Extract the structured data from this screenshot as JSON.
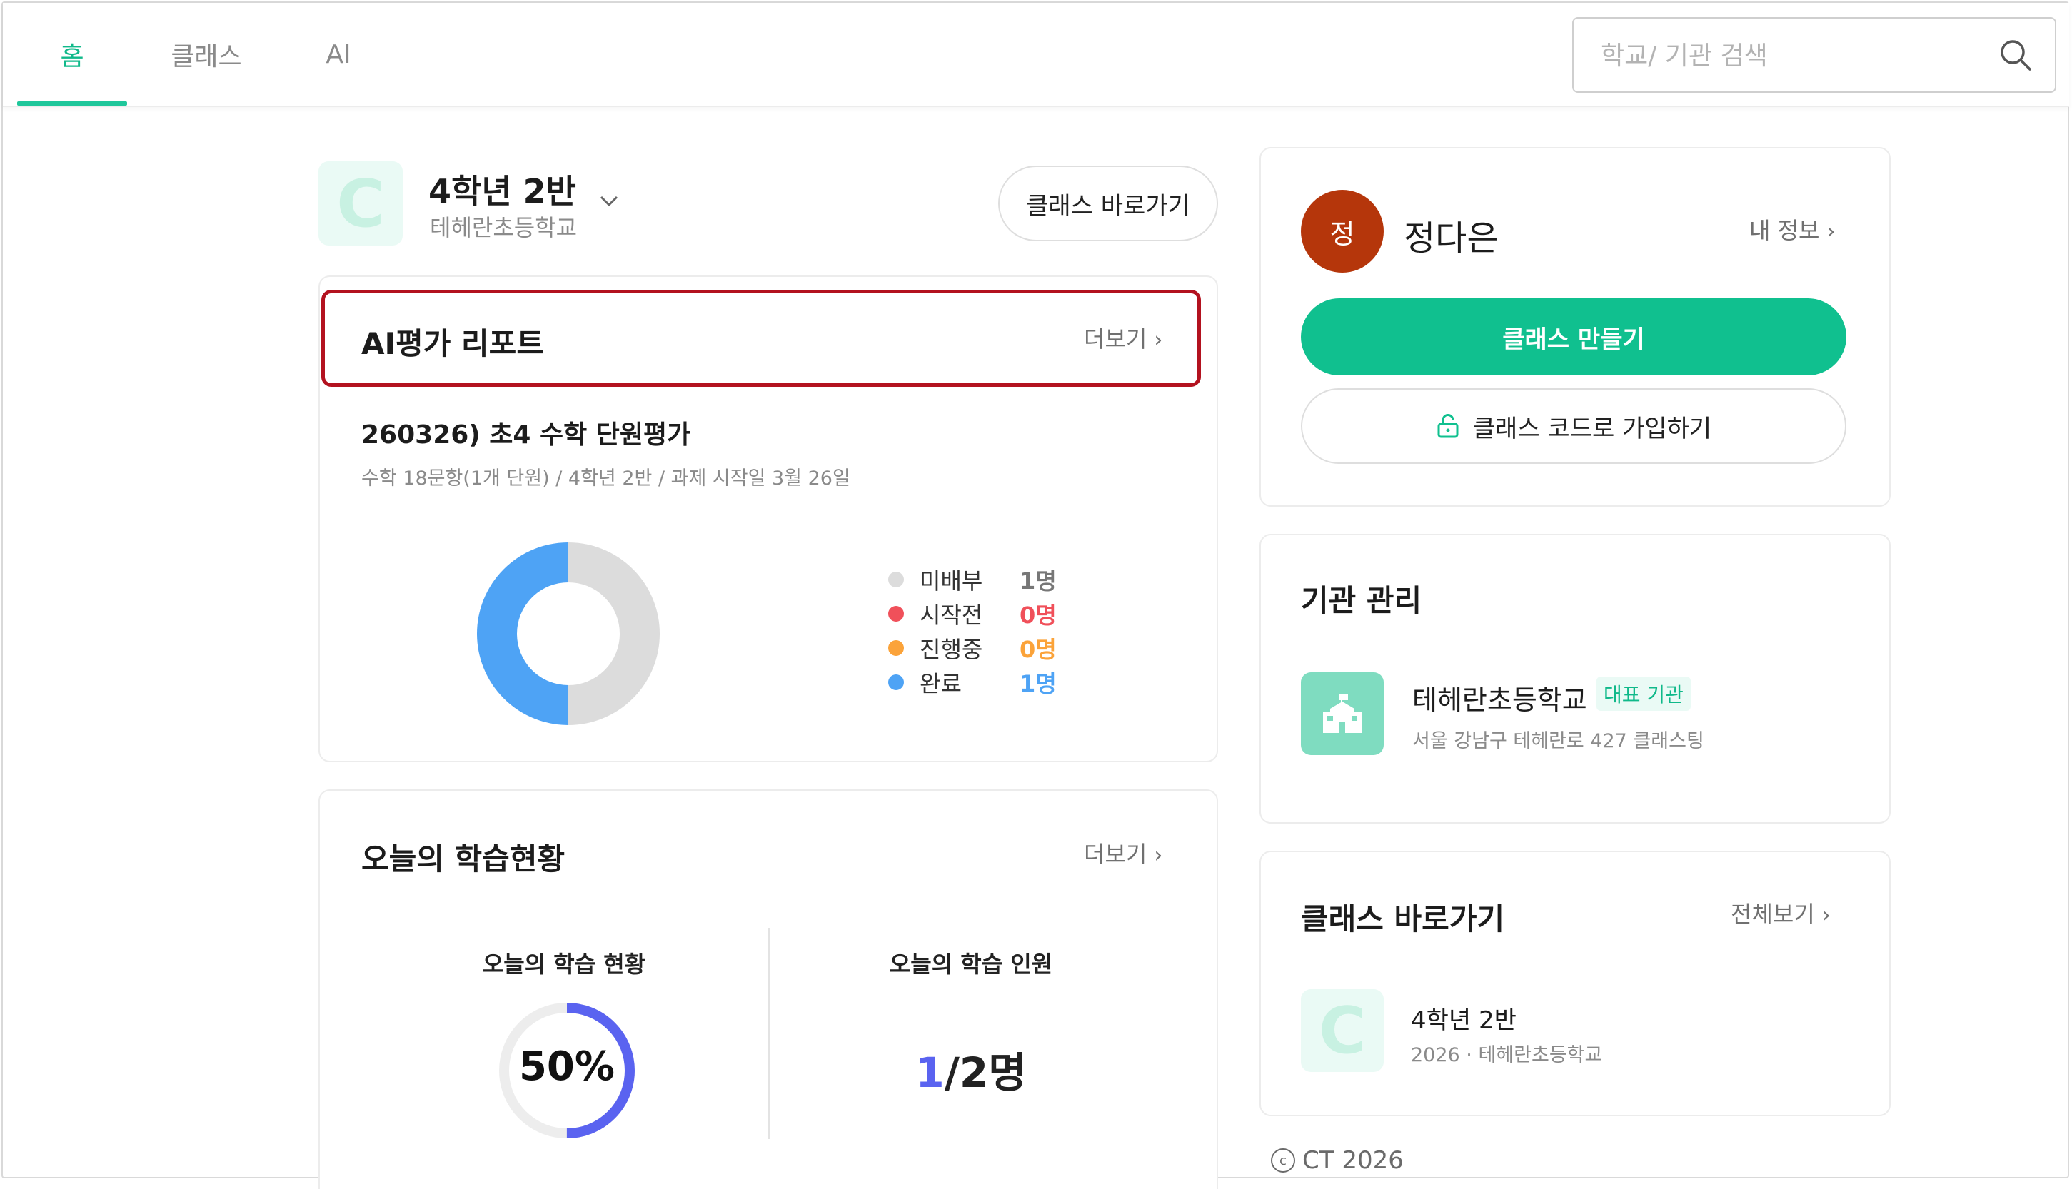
{
  "nav": {
    "tabs": [
      {
        "label": "홈",
        "active": true
      },
      {
        "label": "클래스",
        "active": false
      },
      {
        "label": "AI",
        "active": false
      }
    ],
    "search_placeholder": "학교/ 기관 검색",
    "search_icon": "search-icon"
  },
  "class_header": {
    "logo_letter": "C",
    "class_name": "4학년 2반",
    "school_name": "테헤란초등학교",
    "goto_button": "클래스 바로가기"
  },
  "ai_report": {
    "title": "AI평가 리포트",
    "more": "더보기",
    "assessment_title": "260326) 초4 수학 단원평가",
    "assessment_meta": "수학 18문항(1개 단원) / 4학년 2반 / 과제 시작일 3월 26일",
    "chart_data": {
      "type": "pie",
      "categories": [
        "미배부",
        "시작전",
        "진행중",
        "완료"
      ],
      "values": [
        1,
        0,
        0,
        1
      ],
      "value_labels": [
        "1명",
        "0명",
        "0명",
        "1명"
      ],
      "colors": [
        "#dcdcdc",
        "#f0505a",
        "#fba33a",
        "#4ea3f5"
      ],
      "donut": true,
      "legend": "right"
    }
  },
  "today_learning": {
    "title": "오늘의 학습현황",
    "more": "더보기",
    "status_label": "오늘의 학습 현황",
    "progress_percent": 50,
    "progress_text": "50%",
    "members_label": "오늘의 학습 인원",
    "members_done": "1",
    "members_total": "/2명"
  },
  "profile": {
    "avatar_letter": "정",
    "avatar_color": "#b5360b",
    "name": "정다은",
    "my_info": "내 정보",
    "create_class": "클래스 만들기",
    "join_with_code": "클래스 코드로 가입하기",
    "lock_icon": "unlock-icon"
  },
  "institution": {
    "title": "기관 관리",
    "name": "테헤란초등학교",
    "badge": "대표 기관",
    "address": "서울 강남구 테헤란로 427 클래스팅",
    "icon": "school-building-icon"
  },
  "class_shortcut": {
    "title": "클래스 바로가기",
    "view_all": "전체보기",
    "items": [
      {
        "logo_letter": "C",
        "name": "4학년 2반",
        "meta": "2026 · 테헤란초등학교"
      }
    ]
  },
  "footer": {
    "copyright": "CT 2026"
  },
  "colors": {
    "accent": "#10c08f",
    "highlight_border": "#b3121f",
    "progress": "#5a63f0"
  }
}
